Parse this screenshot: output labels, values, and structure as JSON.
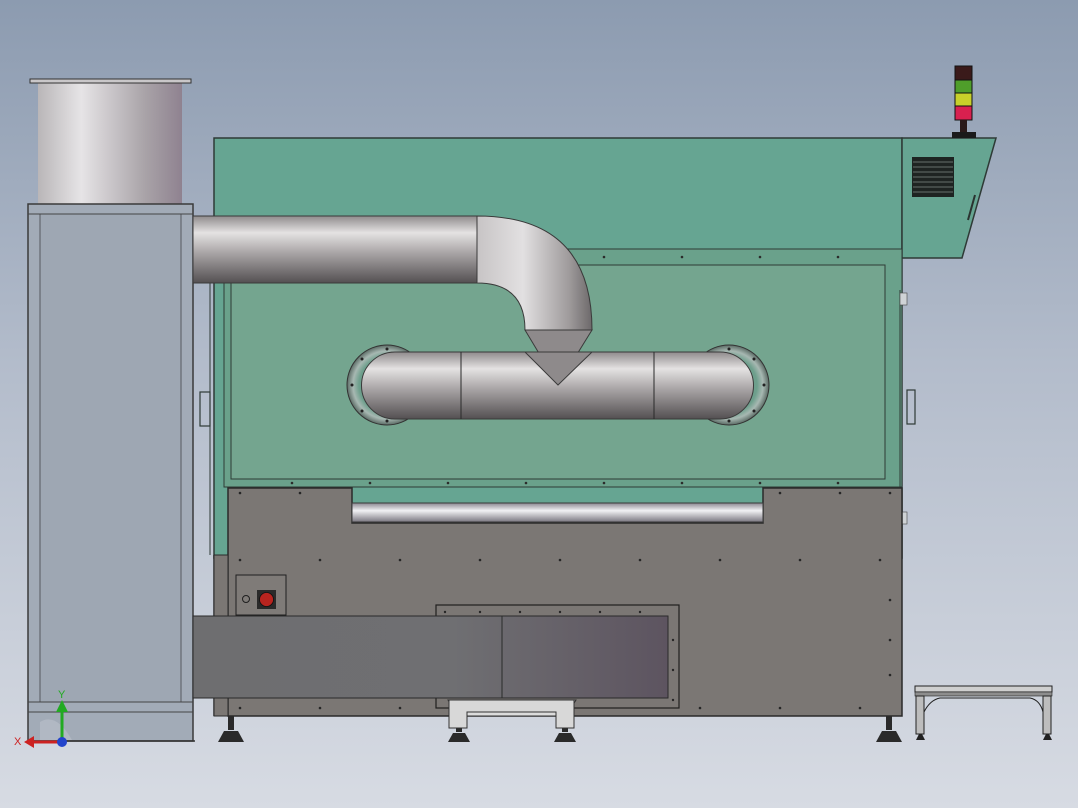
{
  "view": {
    "background_top": "#8c9bb0",
    "background_bottom": "#d7dbe3"
  },
  "colors": {
    "panel_green": "#66a592",
    "window_green": "#74a58f",
    "lower_body_gray": "#7b7774",
    "duct_gray": "#6f6f72",
    "column_glass": "#a2abb7",
    "signal_red": "#d8204f",
    "signal_yellow": "#c8d02a",
    "signal_green": "#4f9e2a",
    "signal_top": "#3a1a1a",
    "stop_button": "#b8241f"
  },
  "triad": {
    "x_label": "X",
    "y_label": "Y"
  },
  "icons": [
    "signal-tower-icon",
    "emergency-stop-icon",
    "vent-grille-icon",
    "coordinate-triad-icon"
  ]
}
